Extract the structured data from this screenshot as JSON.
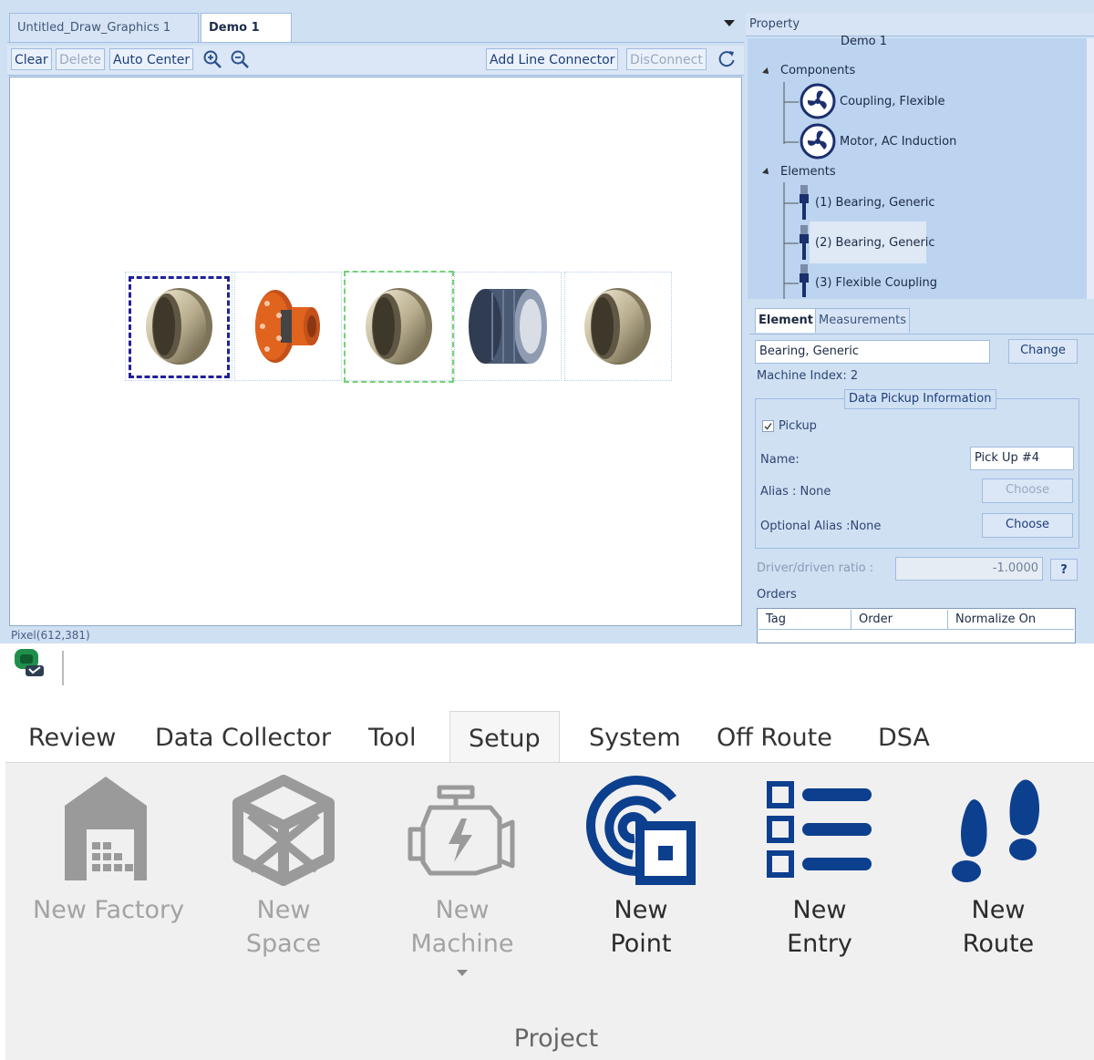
{
  "editor": {
    "tabs": [
      {
        "label": "Untitled_Draw_Graphics 1"
      },
      {
        "label": "Demo 1"
      }
    ],
    "toolbar": {
      "clear": "Clear",
      "delete": "Delete",
      "auto_center": "Auto Center",
      "add_line_connector": "Add Line Connector",
      "disconnect": "DisConnect"
    },
    "status": "Pixel(612,381)",
    "colors": {
      "selection": "#20209a",
      "connector_target": "#74d274",
      "coupling": "#e0631e"
    }
  },
  "property": {
    "title": "Property",
    "tree": {
      "root": "Demo 1",
      "components_label": "Components",
      "components": [
        "Coupling, Flexible",
        "Motor, AC Induction"
      ],
      "elements_label": "Elements",
      "elements": [
        "(1) Bearing, Generic",
        "(2) Bearing, Generic",
        "(3) Flexible Coupling"
      ]
    },
    "subtabs": [
      "Element",
      "Measurements"
    ],
    "element_name": "Bearing, Generic",
    "change_label": "Change",
    "machine_index": "Machine Index: 2",
    "pickup_group": "Data Pickup Information",
    "pickup_label": "Pickup",
    "name_label": "Name:",
    "name_value": "Pick Up #4",
    "alias_label": "Alias : None",
    "choose_label": "Choose",
    "optional_alias_label": "Optional Alias :None",
    "ratio_label": "Driver/driven ratio :",
    "ratio_value": "-1.0000",
    "help_label": "?",
    "orders_label": "Orders",
    "order_columns": [
      "Tag",
      "Order",
      "Normalize On"
    ]
  },
  "ribbon": {
    "menu_tabs": [
      "Review",
      "Data Collector",
      "Tool",
      "Setup",
      "System",
      "Off Route",
      "DSA"
    ],
    "active_tab": "Setup",
    "group_label": "Project",
    "buttons": [
      {
        "label": "New Factory",
        "icon": "factory-icon"
      },
      {
        "label1": "New",
        "label2": "Space",
        "icon": "cube-icon"
      },
      {
        "label1": "New",
        "label2": "Machine",
        "icon": "engine-icon"
      },
      {
        "label1": "New",
        "label2": "Point",
        "icon": "point-icon"
      },
      {
        "label1": "New",
        "label2": "Entry",
        "icon": "list-icon"
      },
      {
        "label1": "New",
        "label2": "Route",
        "icon": "footprints-icon"
      }
    ],
    "colors": {
      "enabled_icon": "#0c3f8e",
      "disabled_icon": "#9a9a9a"
    }
  }
}
